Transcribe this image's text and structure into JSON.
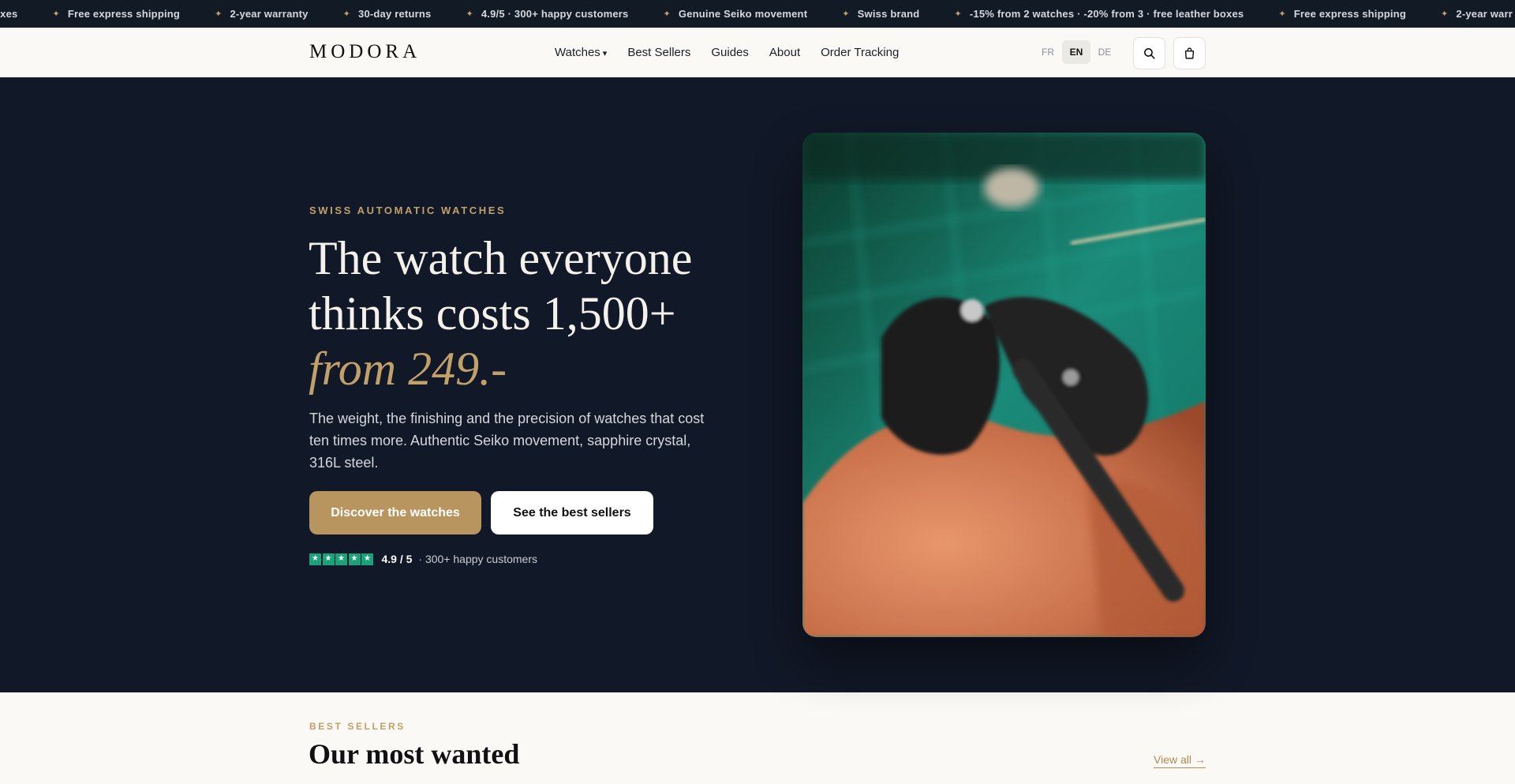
{
  "ticker": {
    "items": [
      "oxes",
      "Free express shipping",
      "2-year warranty",
      "30-day returns",
      "4.9/5 · 300+ happy customers",
      "Genuine Seiko movement",
      "Swiss brand",
      "-15% from 2 watches · -20% from 3 · free leather boxes",
      "Free express shipping",
      "2-year warr"
    ],
    "star_icon": "sparkle-icon"
  },
  "header": {
    "logo": "MODORA",
    "nav": {
      "watches": "Watches",
      "best_sellers": "Best Sellers",
      "guides": "Guides",
      "about": "About",
      "order_tracking": "Order Tracking"
    },
    "languages": [
      "FR",
      "EN",
      "DE"
    ],
    "active_language": "EN",
    "search_icon": "search-icon",
    "cart_icon": "shopping-bag-icon"
  },
  "hero": {
    "eyebrow": "SWISS AUTOMATIC WATCHES",
    "title_line1": "The watch everyone",
    "title_line2": "thinks costs 1,500+",
    "title_accent": "from 249.-",
    "lead": "The weight, the finishing and the precision of watches that cost ten times more. Authentic Seiko movement, sapphire crystal, 316L steel.",
    "cta_primary": "Discover the watches",
    "cta_secondary": "See the best sellers",
    "rating_score": "4.9 / 5",
    "rating_text": "· 300+ happy customers",
    "rating_stars": 5,
    "star_color": "#1aa37a"
  },
  "best_sellers": {
    "eyebrow": "BEST SELLERS",
    "title": "Our most wanted",
    "view_all": "View all →"
  },
  "colors": {
    "accent": "#c2a06a",
    "primary_button": "#b8955f",
    "hero_bg": "#111827",
    "page_bg": "#faf9f6"
  }
}
